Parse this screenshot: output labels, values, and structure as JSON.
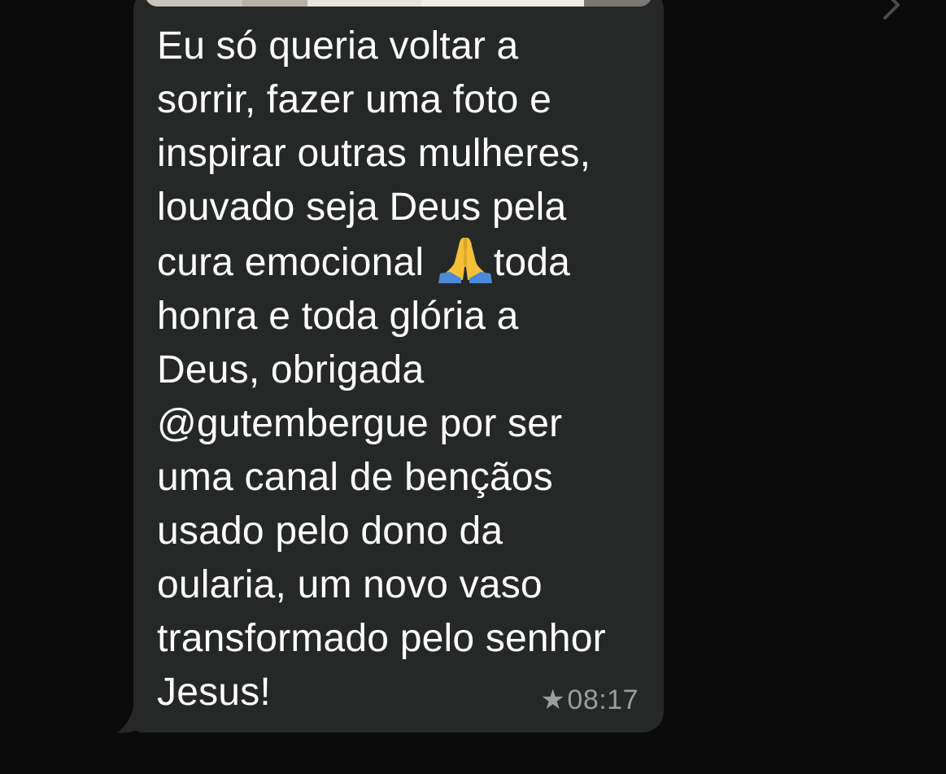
{
  "message": {
    "lines": [
      "Eu só queria voltar a",
      "sorrir, fazer uma foto e",
      "inspirar outras mulheres,",
      "louvado seja Deus pela",
      "cura emocional",
      "toda",
      "honra e toda glória a",
      "Deus, obrigada",
      "@gutembergue por ser",
      "uma canal de bençãos",
      "usado pelo dono da",
      "oularia, um novo vaso",
      "transformado pelo senhor",
      "Jesus!"
    ],
    "emoji": "🙏",
    "time": "08:17",
    "starred_icon": "★"
  },
  "colors": {
    "background": "#0b0b0b",
    "bubble": "#262828",
    "text": "#ffffff",
    "meta": "#9b9d9d"
  },
  "icons": {
    "chevron": "chevron-right-icon",
    "star": "star-icon",
    "emoji": "praying-hands-emoji"
  }
}
